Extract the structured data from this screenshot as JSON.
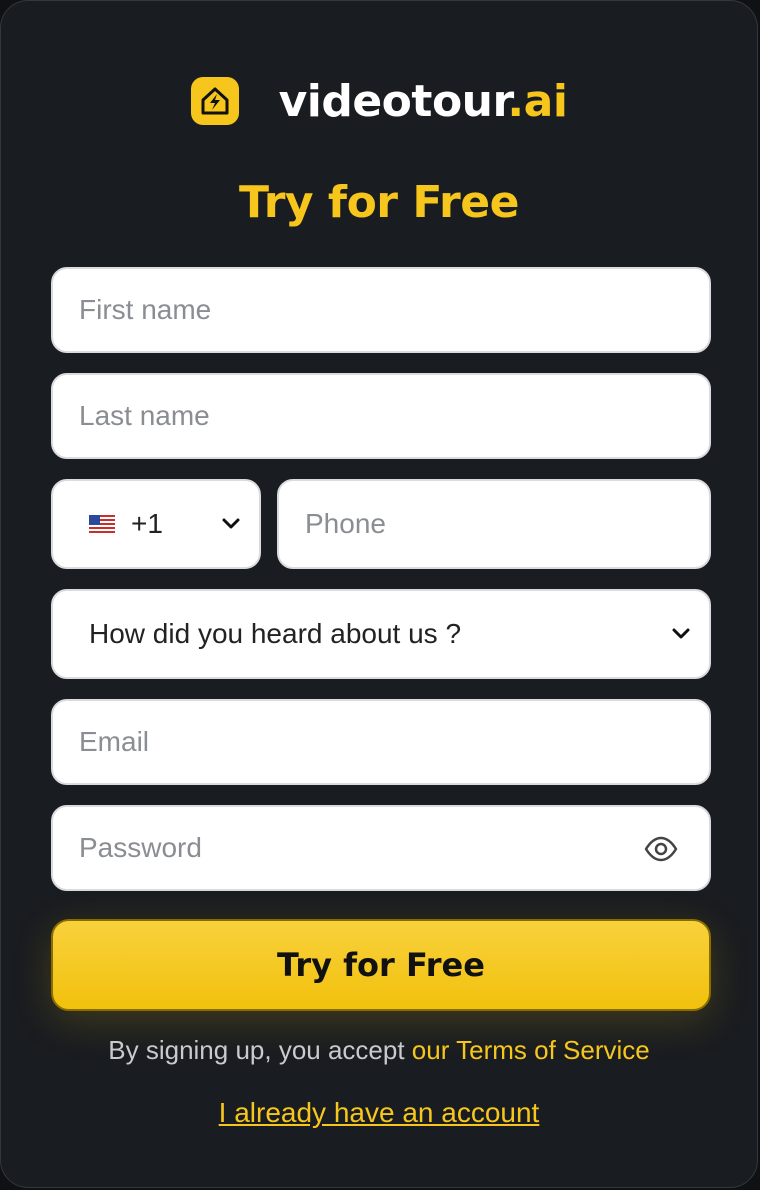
{
  "brand": {
    "name_main": "videotour",
    "name_accent": ".ai",
    "icon": "house-lightning-icon",
    "accent_color": "#f7c61c"
  },
  "form": {
    "title": "Try for Free",
    "first_name_placeholder": "First name",
    "last_name_placeholder": "Last name",
    "country_code": "+1",
    "country_flag": "us-flag-icon",
    "phone_placeholder": "Phone",
    "referral_select": "How did you heard about us ?",
    "email_placeholder": "Email",
    "password_placeholder": "Password",
    "submit_label": "Try for Free"
  },
  "footer": {
    "terms_prefix": "By signing up, you accept ",
    "terms_link": "our Terms of Service",
    "login_link": "I already have an account"
  }
}
